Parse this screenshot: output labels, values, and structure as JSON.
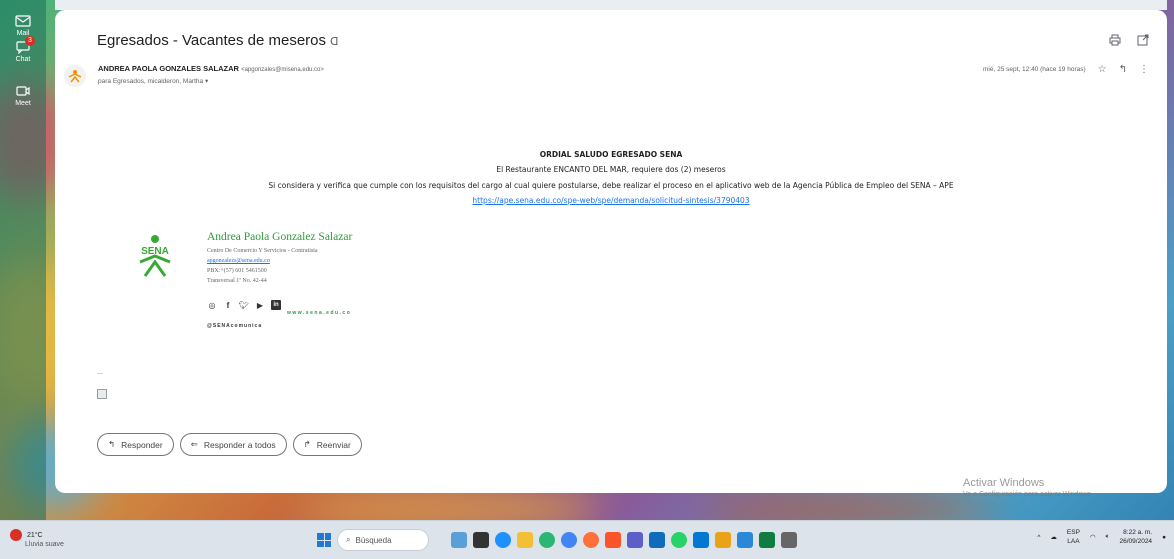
{
  "rail": {
    "items": [
      {
        "label": "Mail",
        "icon": "mail-icon"
      },
      {
        "label": "Chat",
        "icon": "chat-icon",
        "badge": "3"
      },
      {
        "label": "Meet",
        "icon": "meet-icon"
      }
    ]
  },
  "email": {
    "subject": "Egresados - Vacantes de meseros",
    "sender_name": "ANDREA PAOLA GONZALES SALAZAR",
    "sender_address": "<apgonzales@misena.edu.co>",
    "recipients": "para Egresados, micalderon, Martha",
    "date": "mié, 25 sept, 12:40 (hace 19 horas)",
    "body": {
      "title": "ORDIAL SALUDO EGRESADO SENA",
      "line1": "El Restaurante ENCANTO DEL MAR, requiere  dos (2) meseros",
      "line2": "Si considera y verifica que cumple con los requisitos del cargo al cual quiere postularse, debe realizar el proceso  en el aplicativo web de la Agencia Pública de Empleo del SENA – APE",
      "link": "https://ape.sena.edu.co/spe-web/spe/demanda/solicitud-sintesis/3790403"
    },
    "signature": {
      "logo_text": "SENA",
      "name": "Andrea Paola Gonzalez Salazar",
      "role": "Centro De Comercio Y Servicios - Contratista",
      "email": "apgonzalezs@sena.edu.co",
      "phone": "PBX:+(57) 601 5461500",
      "address": "Transversal 1ª No. 42-44",
      "website": "www.sena.edu.co",
      "handle": "@SENAcomunica"
    },
    "trimmed": "...",
    "actions": {
      "reply": "Responder",
      "reply_all": "Responder a todos",
      "forward": "Reenviar"
    }
  },
  "watermark": {
    "line1": "Activar Windows",
    "line2": "Ve a Configuración para activar Windows."
  },
  "taskbar": {
    "weather_temp": "21°C",
    "weather_desc": "Lluvia suave",
    "search_placeholder": "Búsqueda",
    "lang": "ESP",
    "lang_sub": "LAA",
    "time": "8:22 a. m.",
    "date": "26/09/2024"
  },
  "colors": {
    "accent": "#1a73e8",
    "sena_green": "#2e9b3b",
    "badge": "#d93025"
  }
}
